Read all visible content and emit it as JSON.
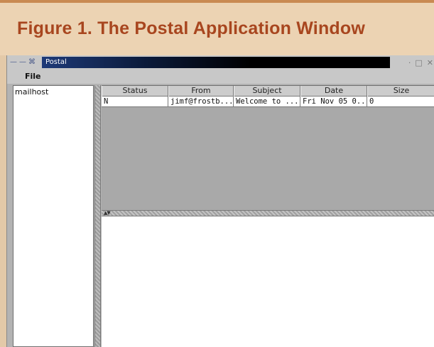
{
  "figure": {
    "title": "Figure 1. The Postal Application Window"
  },
  "window": {
    "title": "Postal",
    "controls_left": [
      "—",
      "—",
      "⌘"
    ],
    "controls_right": [
      "·",
      "□",
      "✕"
    ]
  },
  "menubar": {
    "file_label": "File"
  },
  "folders": [
    {
      "label": "mailhost"
    }
  ],
  "table": {
    "columns": [
      "Status",
      "From",
      "Subject",
      "Date",
      "Size"
    ],
    "rows": [
      {
        "status": "N",
        "from": "jimf@frostb...",
        "subject": "Welcome to ...",
        "date": "Fri Nov 05 0...",
        "size": "0"
      }
    ]
  },
  "splitter": {
    "arrows": "▲▼"
  },
  "colors": {
    "figure_title": "#a8461f",
    "banner_bg": "#ecd3b3",
    "titlebar_active": "#000000",
    "pane_bg": "#a9a9a9"
  },
  "icons": {
    "window_menu": "window-menu-icon",
    "minimize": "minimize-icon",
    "maximize": "maximize-icon",
    "close": "close-icon"
  }
}
